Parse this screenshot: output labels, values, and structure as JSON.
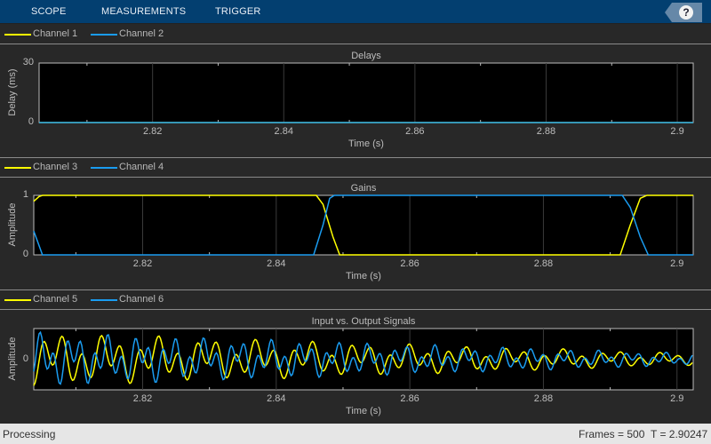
{
  "toolbar": {
    "tabs": [
      "SCOPE",
      "MEASUREMENTS",
      "TRIGGER"
    ],
    "help_icon": "?"
  },
  "colors": {
    "yellow": "#ffff00",
    "blue": "#1a9cf0",
    "toolbar": "#033f70"
  },
  "plots": [
    {
      "legend": [
        "Channel 1",
        "Channel 2"
      ],
      "title": "Delays",
      "ylabel": "Delay (ms)",
      "xlabel": "Time (s)",
      "yticks": [
        "30",
        "0"
      ],
      "ylim": [
        0,
        30
      ],
      "xlim": [
        2.8027,
        2.90243
      ],
      "xticks": [
        "2.82",
        "2.84",
        "2.86",
        "2.88",
        "2.9"
      ],
      "series": [
        {
          "color": "#ffff00",
          "points": [
            [
              2.8027,
              0
            ],
            [
              2.90243,
              0
            ]
          ]
        },
        {
          "color": "#1a9cf0",
          "points": [
            [
              2.8027,
              0
            ],
            [
              2.90243,
              0
            ]
          ]
        }
      ]
    },
    {
      "legend": [
        "Channel 3",
        "Channel 4"
      ],
      "title": "Gains",
      "ylabel": "Amplitude",
      "xlabel": "Time (s)",
      "yticks": [
        "1",
        "0"
      ],
      "ylim": [
        0,
        1
      ],
      "xlim": [
        2.8037,
        2.90243
      ],
      "xticks": [
        "2.82",
        "2.84",
        "2.86",
        "2.88",
        "2.9"
      ],
      "series": [
        {
          "color": "#ffff00",
          "points": [
            [
              2.8037,
              0.9
            ],
            [
              2.8045,
              0.98
            ],
            [
              2.805,
              1
            ],
            [
              2.846,
              1
            ],
            [
              2.847,
              0.85
            ],
            [
              2.8485,
              0.3
            ],
            [
              2.8495,
              0
            ],
            [
              2.8915,
              0
            ],
            [
              2.893,
              0.5
            ],
            [
              2.8945,
              0.95
            ],
            [
              2.8955,
              1
            ],
            [
              2.90243,
              1
            ]
          ]
        },
        {
          "color": "#1a9cf0",
          "points": [
            [
              2.8037,
              0.4
            ],
            [
              2.805,
              0
            ],
            [
              2.8456,
              0
            ],
            [
              2.847,
              0.5
            ],
            [
              2.848,
              0.95
            ],
            [
              2.8487,
              1
            ],
            [
              2.8918,
              1
            ],
            [
              2.893,
              0.8
            ],
            [
              2.8945,
              0.3
            ],
            [
              2.8957,
              0
            ],
            [
              2.90243,
              0
            ]
          ]
        }
      ]
    },
    {
      "legend": [
        "Channel 5",
        "Channel 6"
      ],
      "title": "Input vs. Output Signals",
      "ylabel": "Amplitude",
      "xlabel": "Time (s)",
      "yticks": [
        "0"
      ],
      "ylim": [
        -1,
        1
      ],
      "xlim": [
        2.8037,
        2.90243
      ],
      "xticks": [
        "2.82",
        "2.84",
        "2.86",
        "2.88",
        "2.9"
      ],
      "series": [
        {
          "color": "#ffff00"
        },
        {
          "color": "#1a9cf0"
        }
      ]
    }
  ],
  "status": {
    "left": "Processing",
    "frames": "Frames = 500",
    "time": "T = 2.90247"
  }
}
